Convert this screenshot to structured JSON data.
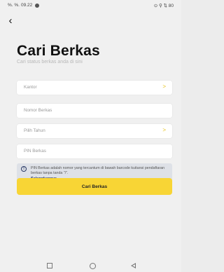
{
  "status_bar": {
    "signal_text": "%. %.",
    "time": "09.22",
    "right_text": "⊙ ⚲ ⇅ 80"
  },
  "header": {
    "title": "Cari Berkas",
    "subtitle": "Cari status berkas anda di sini"
  },
  "form": {
    "fields": [
      {
        "label": "Kantor",
        "has_chevron": true
      },
      {
        "label": "Nomor Berkas",
        "has_chevron": false
      },
      {
        "label": "Pilih Tahun",
        "has_chevron": true
      },
      {
        "label": "PIN Berkas",
        "has_chevron": false
      }
    ],
    "chevron": ">",
    "info": {
      "icon": "info-icon",
      "text": "PIN Berkas adalah nomor yang tercantum di bawah barcode kuitansi pendaftaran berkas tanpa tanda \"/\".",
      "link": "Selengkapnya"
    },
    "submit_label": "Cari Berkas"
  },
  "colors": {
    "accent": "#f8d535",
    "chevron": "#e6c21c",
    "info_bg": "#dee1e7"
  }
}
